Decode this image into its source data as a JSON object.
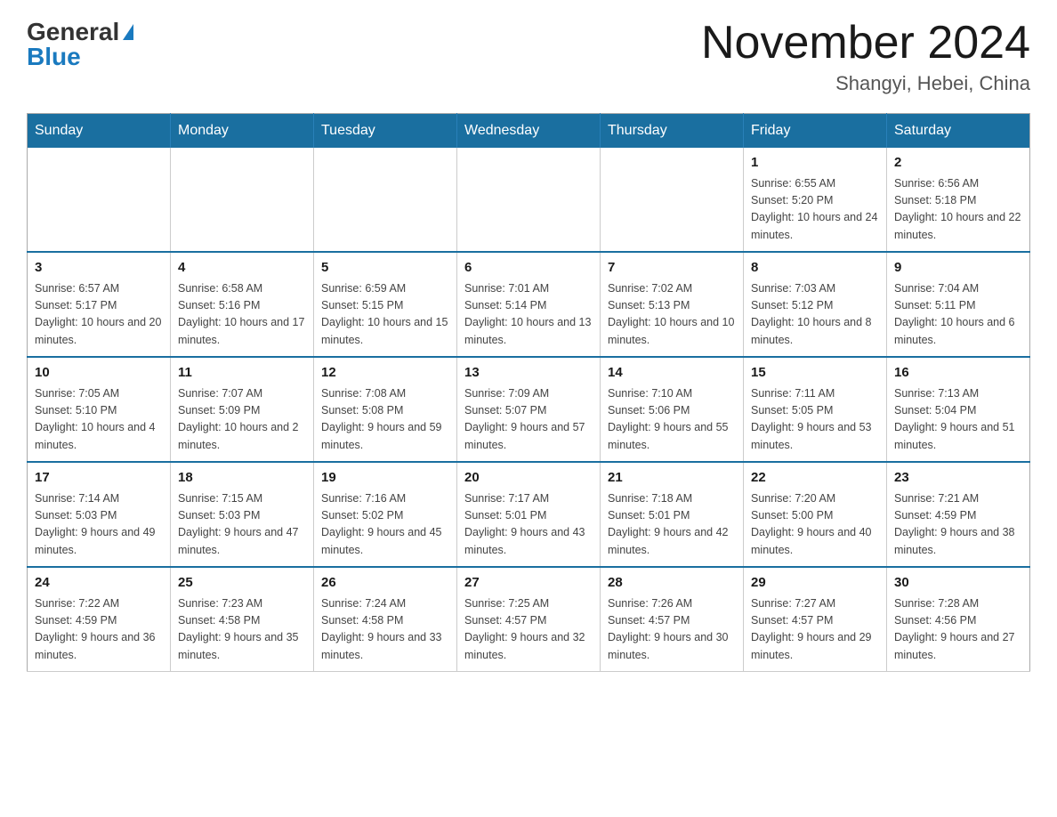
{
  "header": {
    "logo_general": "General",
    "logo_blue": "Blue",
    "month_title": "November 2024",
    "location": "Shangyi, Hebei, China"
  },
  "days_of_week": [
    "Sunday",
    "Monday",
    "Tuesday",
    "Wednesday",
    "Thursday",
    "Friday",
    "Saturday"
  ],
  "weeks": [
    {
      "days": [
        {
          "num": "",
          "info": ""
        },
        {
          "num": "",
          "info": ""
        },
        {
          "num": "",
          "info": ""
        },
        {
          "num": "",
          "info": ""
        },
        {
          "num": "",
          "info": ""
        },
        {
          "num": "1",
          "info": "Sunrise: 6:55 AM\nSunset: 5:20 PM\nDaylight: 10 hours and 24 minutes."
        },
        {
          "num": "2",
          "info": "Sunrise: 6:56 AM\nSunset: 5:18 PM\nDaylight: 10 hours and 22 minutes."
        }
      ]
    },
    {
      "days": [
        {
          "num": "3",
          "info": "Sunrise: 6:57 AM\nSunset: 5:17 PM\nDaylight: 10 hours and 20 minutes."
        },
        {
          "num": "4",
          "info": "Sunrise: 6:58 AM\nSunset: 5:16 PM\nDaylight: 10 hours and 17 minutes."
        },
        {
          "num": "5",
          "info": "Sunrise: 6:59 AM\nSunset: 5:15 PM\nDaylight: 10 hours and 15 minutes."
        },
        {
          "num": "6",
          "info": "Sunrise: 7:01 AM\nSunset: 5:14 PM\nDaylight: 10 hours and 13 minutes."
        },
        {
          "num": "7",
          "info": "Sunrise: 7:02 AM\nSunset: 5:13 PM\nDaylight: 10 hours and 10 minutes."
        },
        {
          "num": "8",
          "info": "Sunrise: 7:03 AM\nSunset: 5:12 PM\nDaylight: 10 hours and 8 minutes."
        },
        {
          "num": "9",
          "info": "Sunrise: 7:04 AM\nSunset: 5:11 PM\nDaylight: 10 hours and 6 minutes."
        }
      ]
    },
    {
      "days": [
        {
          "num": "10",
          "info": "Sunrise: 7:05 AM\nSunset: 5:10 PM\nDaylight: 10 hours and 4 minutes."
        },
        {
          "num": "11",
          "info": "Sunrise: 7:07 AM\nSunset: 5:09 PM\nDaylight: 10 hours and 2 minutes."
        },
        {
          "num": "12",
          "info": "Sunrise: 7:08 AM\nSunset: 5:08 PM\nDaylight: 9 hours and 59 minutes."
        },
        {
          "num": "13",
          "info": "Sunrise: 7:09 AM\nSunset: 5:07 PM\nDaylight: 9 hours and 57 minutes."
        },
        {
          "num": "14",
          "info": "Sunrise: 7:10 AM\nSunset: 5:06 PM\nDaylight: 9 hours and 55 minutes."
        },
        {
          "num": "15",
          "info": "Sunrise: 7:11 AM\nSunset: 5:05 PM\nDaylight: 9 hours and 53 minutes."
        },
        {
          "num": "16",
          "info": "Sunrise: 7:13 AM\nSunset: 5:04 PM\nDaylight: 9 hours and 51 minutes."
        }
      ]
    },
    {
      "days": [
        {
          "num": "17",
          "info": "Sunrise: 7:14 AM\nSunset: 5:03 PM\nDaylight: 9 hours and 49 minutes."
        },
        {
          "num": "18",
          "info": "Sunrise: 7:15 AM\nSunset: 5:03 PM\nDaylight: 9 hours and 47 minutes."
        },
        {
          "num": "19",
          "info": "Sunrise: 7:16 AM\nSunset: 5:02 PM\nDaylight: 9 hours and 45 minutes."
        },
        {
          "num": "20",
          "info": "Sunrise: 7:17 AM\nSunset: 5:01 PM\nDaylight: 9 hours and 43 minutes."
        },
        {
          "num": "21",
          "info": "Sunrise: 7:18 AM\nSunset: 5:01 PM\nDaylight: 9 hours and 42 minutes."
        },
        {
          "num": "22",
          "info": "Sunrise: 7:20 AM\nSunset: 5:00 PM\nDaylight: 9 hours and 40 minutes."
        },
        {
          "num": "23",
          "info": "Sunrise: 7:21 AM\nSunset: 4:59 PM\nDaylight: 9 hours and 38 minutes."
        }
      ]
    },
    {
      "days": [
        {
          "num": "24",
          "info": "Sunrise: 7:22 AM\nSunset: 4:59 PM\nDaylight: 9 hours and 36 minutes."
        },
        {
          "num": "25",
          "info": "Sunrise: 7:23 AM\nSunset: 4:58 PM\nDaylight: 9 hours and 35 minutes."
        },
        {
          "num": "26",
          "info": "Sunrise: 7:24 AM\nSunset: 4:58 PM\nDaylight: 9 hours and 33 minutes."
        },
        {
          "num": "27",
          "info": "Sunrise: 7:25 AM\nSunset: 4:57 PM\nDaylight: 9 hours and 32 minutes."
        },
        {
          "num": "28",
          "info": "Sunrise: 7:26 AM\nSunset: 4:57 PM\nDaylight: 9 hours and 30 minutes."
        },
        {
          "num": "29",
          "info": "Sunrise: 7:27 AM\nSunset: 4:57 PM\nDaylight: 9 hours and 29 minutes."
        },
        {
          "num": "30",
          "info": "Sunrise: 7:28 AM\nSunset: 4:56 PM\nDaylight: 9 hours and 27 minutes."
        }
      ]
    }
  ]
}
